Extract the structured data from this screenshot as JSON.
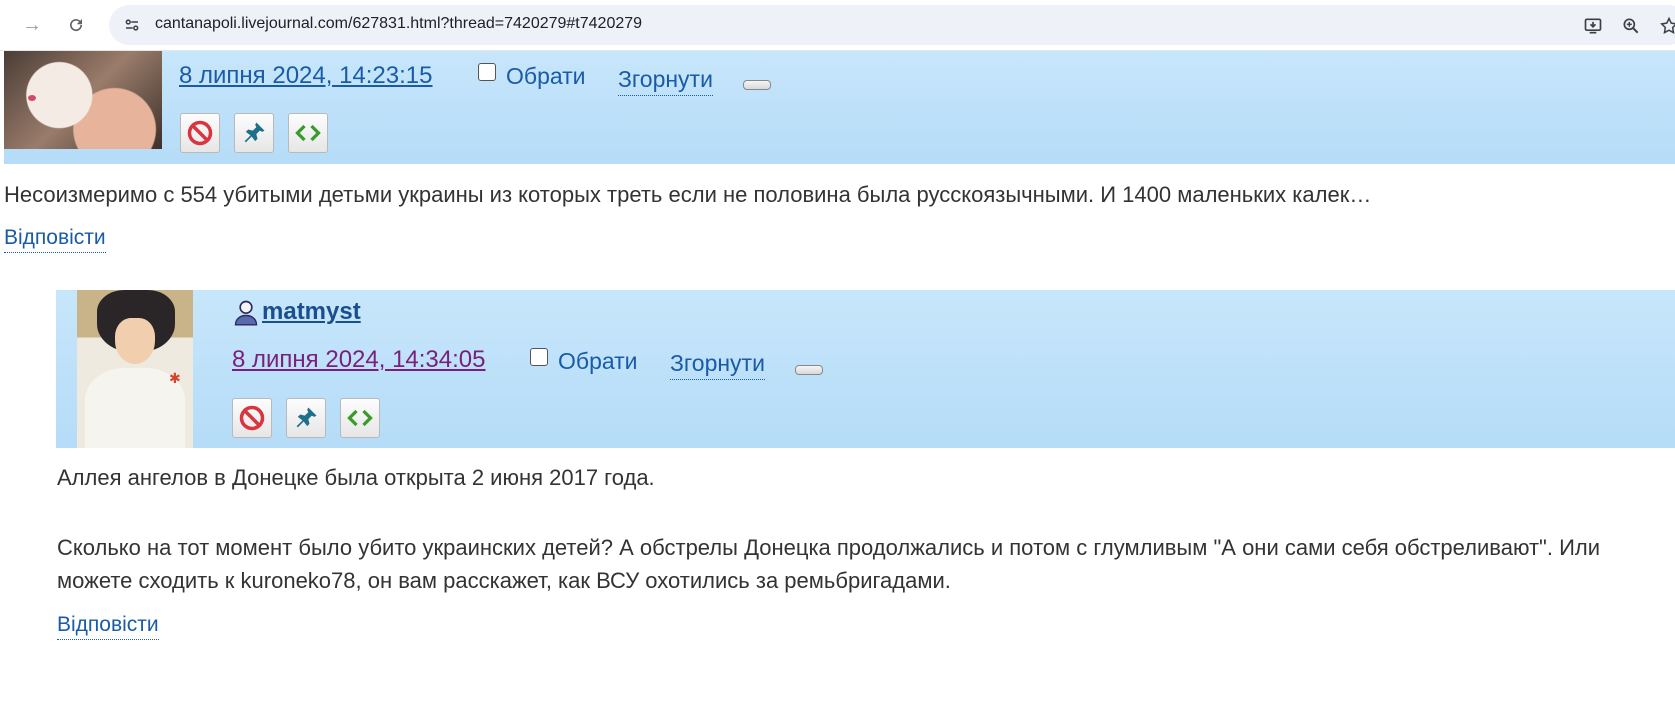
{
  "browser": {
    "url": "cantanapoli.livejournal.com/627831.html?thread=7420279#t7420279",
    "icons": [
      "forward-icon",
      "reload-icon",
      "site-info-icon",
      "install-app-icon",
      "zoom-icon",
      "bookmark-star-icon"
    ]
  },
  "comments": [
    {
      "username": "",
      "date": "8 липня 2024, 14:23:15",
      "select_label": "Обрати",
      "collapse_label": "Згорнути",
      "text": "Несоизмеримо с 554 убитыми детьми украины из которых треть если не половина была русскоязычными. И 1400 маленьких калек…",
      "reply_label": "Відповісти"
    },
    {
      "username": "matmyst",
      "date": "8 липня 2024, 14:34:05",
      "select_label": "Обрати",
      "collapse_label": "Згорнути",
      "text_1": "Аллея ангелов в Донецке была открыта 2 июня 2017 года.",
      "text_2": "Сколько на тот момент было убито украинских детей? А обстрелы Донецка продолжались и потом с глумливым \"А они сами себя обстреливают\". Или можете сходить к kuroneko78, он вам расскажет, как ВСУ охотились за ремьбригадами.",
      "reply_label": "Відповісти"
    }
  ],
  "colors": {
    "header_bg": "#b9ddf8",
    "link": "#1a5ba8",
    "visited_link": "#7a1f7a",
    "ban_red": "#d9343f",
    "pin_teal": "#1e6f8c",
    "code_green": "#3a9a2a"
  }
}
